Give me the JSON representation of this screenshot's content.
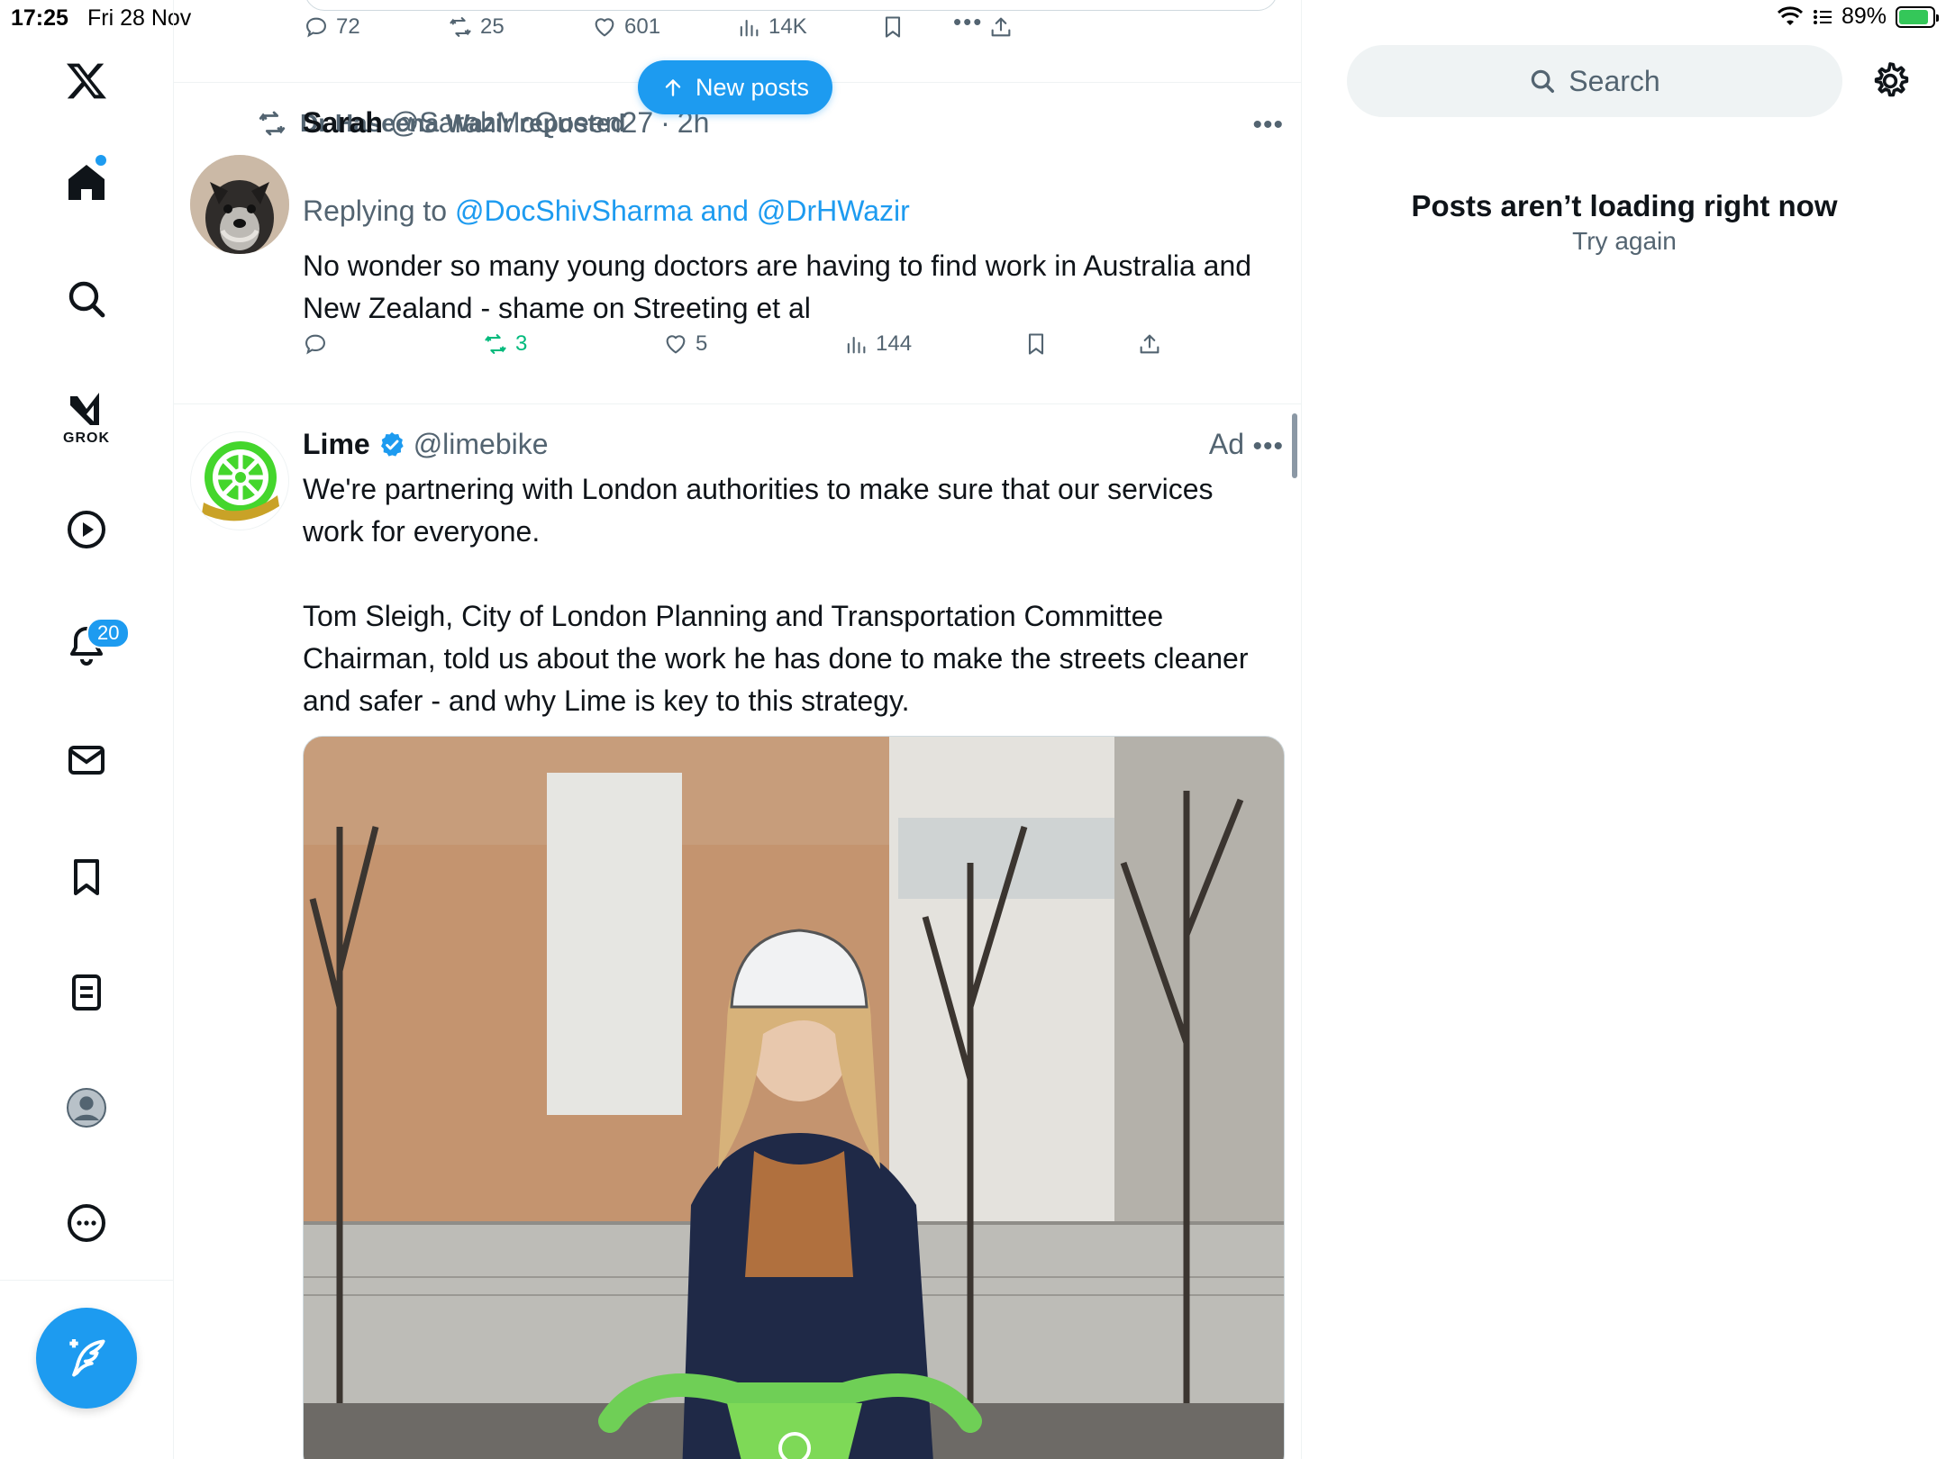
{
  "status_bar": {
    "time": "17:25",
    "date": "Fri 28 Nov",
    "battery": "89%",
    "battery_level": 0.89
  },
  "sidebar": {
    "grok_label": "GROK",
    "notifications_badge": "20",
    "icons": [
      "x-logo-icon",
      "home-icon",
      "search-icon",
      "grok-icon",
      "video-icon",
      "bell-icon",
      "mail-icon",
      "bookmark-icon",
      "lists-icon",
      "profile-icon",
      "more-icon",
      "compose-icon"
    ]
  },
  "top_post_actions": {
    "replies": "72",
    "reposts": "25",
    "likes": "601",
    "views": "14K"
  },
  "new_posts_label": "New posts",
  "post1": {
    "repost_by": "Dr Haseena Wazir reposted",
    "name": "Sarah",
    "handle": "@SarahMcQueen27",
    "sep": "·",
    "time": "2h",
    "replying_prefix": "Replying to",
    "replying_mentions": "@DocShivSharma and @DrHWazir",
    "text": "No wonder so many young doctors are having to find work in Australia and New Zealand - shame on Streeting et al",
    "reposts": "3",
    "likes": "5",
    "views": "144"
  },
  "post2": {
    "name": "Lime",
    "handle": "@limebike",
    "ad_label": "Ad",
    "logo_text": "ONE BILLION RIDES",
    "text": "We're partnering with London authorities to make sure that our services work for everyone.\n\nTom Sleigh, City of London Planning and Transportation Committee Chairman, told us about the work he has done to make the streets cleaner and safer - and why Lime is key to this strategy."
  },
  "right_panel": {
    "search_placeholder": "Search",
    "error_title": "Posts aren’t loading right now",
    "error_action": "Try again"
  },
  "colors": {
    "accent": "#1d9bf0",
    "muted": "#536471",
    "repost_green": "#00ba7c",
    "lime_green": "#44d62c"
  }
}
